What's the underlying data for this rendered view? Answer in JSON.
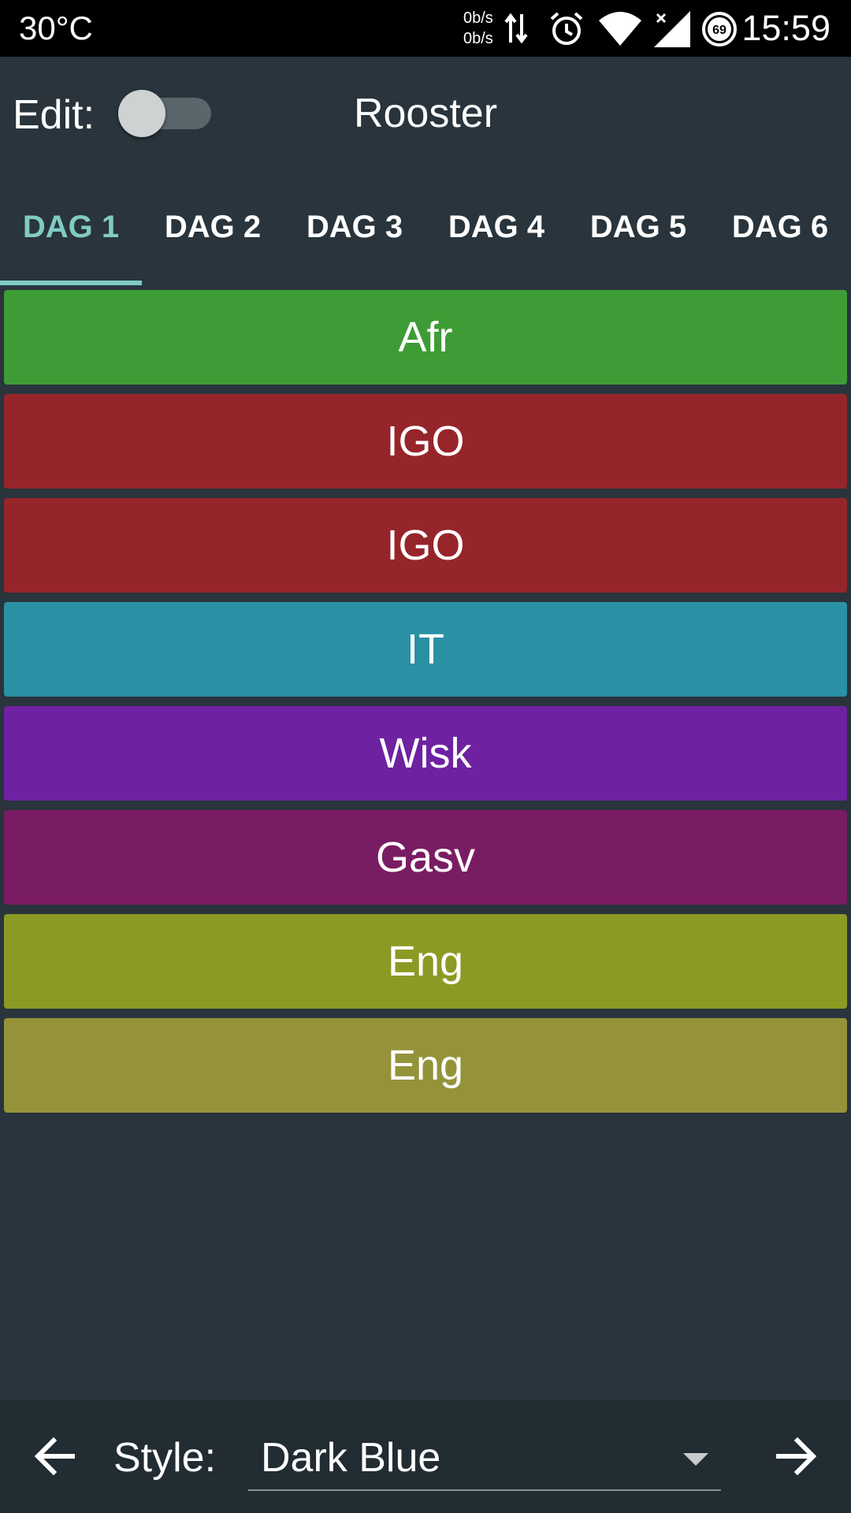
{
  "status_bar": {
    "temperature": "30°C",
    "net_up": "0b/s",
    "net_down": "0b/s",
    "battery_level": "69",
    "time": "15:59",
    "icons": [
      "data-transfer-icon",
      "alarm-icon",
      "wifi-icon",
      "signal-icon",
      "battery-icon"
    ]
  },
  "header": {
    "edit_label": "Edit:",
    "edit_toggle_on": false,
    "title": "Rooster"
  },
  "tabs": [
    {
      "label": "DAG 1",
      "active": true
    },
    {
      "label": "DAG 2",
      "active": false
    },
    {
      "label": "DAG 3",
      "active": false
    },
    {
      "label": "DAG 4",
      "active": false
    },
    {
      "label": "DAG 5",
      "active": false
    },
    {
      "label": "DAG 6",
      "active": false
    }
  ],
  "lessons": [
    {
      "label": "Afr",
      "color": "#3d9c35"
    },
    {
      "label": "IGO",
      "color": "#96252b"
    },
    {
      "label": "IGO",
      "color": "#96252b"
    },
    {
      "label": "IT",
      "color": "#2a90a4"
    },
    {
      "label": "Wisk",
      "color": "#6e22a2"
    },
    {
      "label": "Gasv",
      "color": "#7a1c63"
    },
    {
      "label": "Eng",
      "color": "#8c9a23"
    },
    {
      "label": "Eng",
      "color": "#959339"
    }
  ],
  "bottom_bar": {
    "style_label": "Style:",
    "style_value": "Dark Blue"
  },
  "colors": {
    "background": "#29343c",
    "accent": "#80cbc4",
    "bottom_bar": "#222c33"
  }
}
